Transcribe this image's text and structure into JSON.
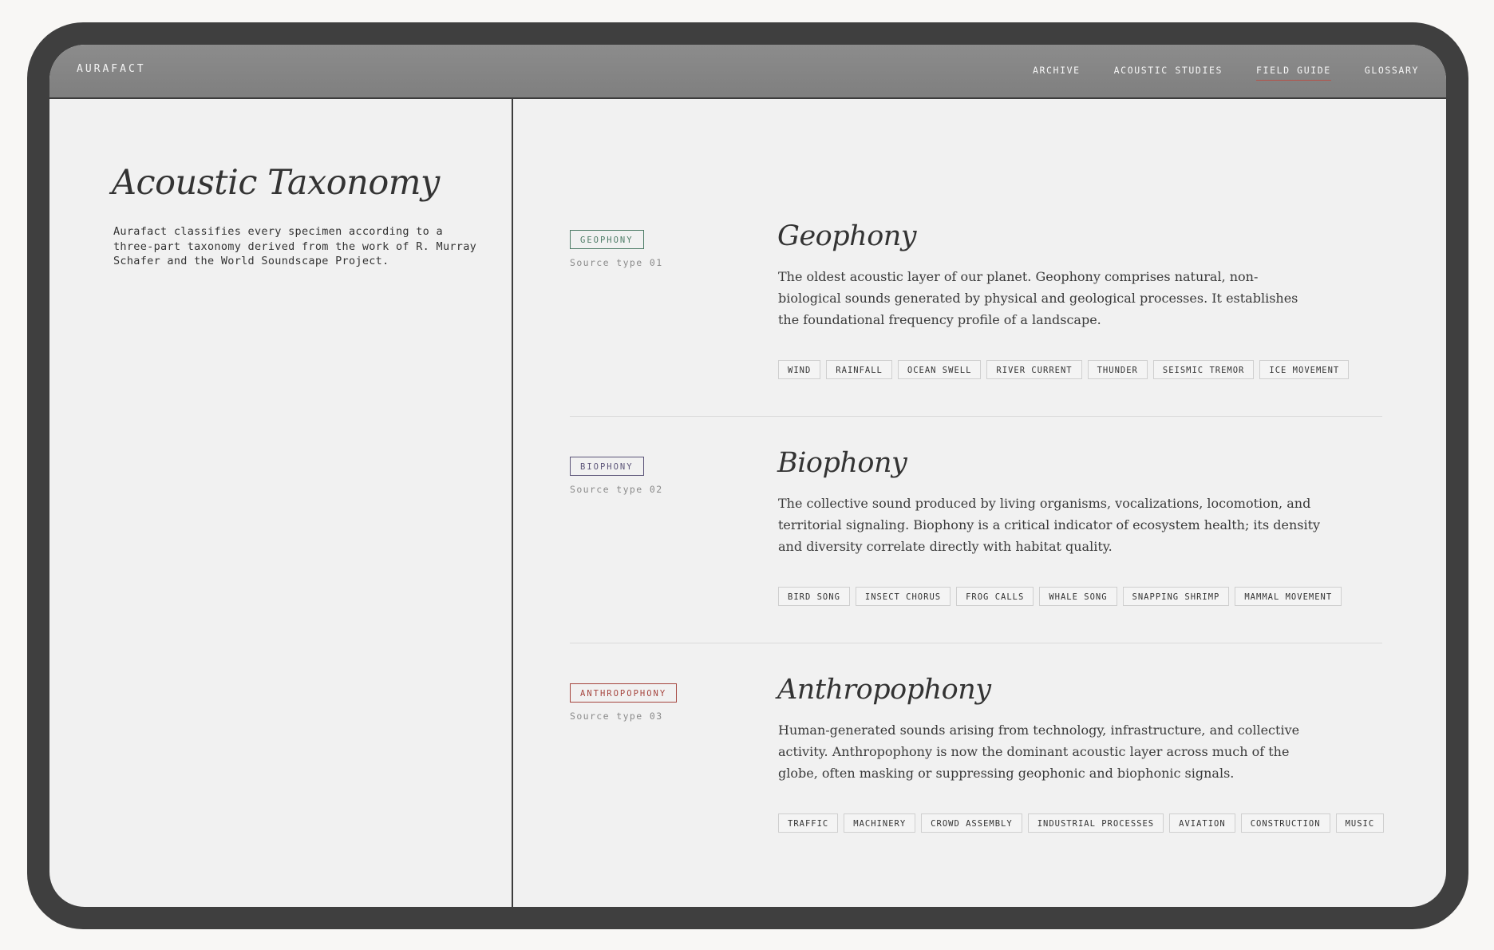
{
  "header": {
    "brand": "AURAFACT",
    "nav": [
      "ARCHIVE",
      "ACOUSTIC STUDIES",
      "FIELD GUIDE",
      "GLOSSARY"
    ],
    "active_nav": "FIELD GUIDE"
  },
  "sidebar": {
    "title": "Acoustic Taxonomy",
    "intro": "Aurafact classifies every specimen according to a three-part taxonomy derived from the work of R. Murray Schafer and the World Soundscape Project."
  },
  "colors": {
    "accent": "#b5524a",
    "geophony": "#4e7c67",
    "biophony": "#5b5478",
    "anthropophony": "#a5453e"
  },
  "sections": [
    {
      "badge": "GEOPHONY",
      "source_type": "Source type 01",
      "title": "Geophony",
      "description": "The oldest acoustic layer of our planet. Geophony comprises natural, non-biological sounds generated by physical and geological processes. It establishes the foundational frequency profile of a landscape.",
      "tags": [
        "WIND",
        "RAINFALL",
        "OCEAN SWELL",
        "RIVER CURRENT",
        "THUNDER",
        "SEISMIC TREMOR",
        "ICE MOVEMENT"
      ]
    },
    {
      "badge": "BIOPHONY",
      "source_type": "Source type 02",
      "title": "Biophony",
      "description": "The collective sound produced by living organisms, vocalizations, locomotion, and territorial signaling. Biophony is a critical indicator of ecosystem health; its density and diversity correlate directly with habitat quality.",
      "tags": [
        "BIRD SONG",
        "INSECT CHORUS",
        "FROG CALLS",
        "WHALE SONG",
        "SNAPPING SHRIMP",
        "MAMMAL MOVEMENT"
      ]
    },
    {
      "badge": "ANTHROPOPHONY",
      "source_type": "Source type 03",
      "title": "Anthropophony",
      "description": "Human-generated sounds arising from technology, infrastructure, and collective activity. Anthropophony is now the dominant acoustic layer across much of the globe, often masking or suppressing geophonic and biophonic signals.",
      "tags": [
        "TRAFFIC",
        "MACHINERY",
        "CROWD ASSEMBLY",
        "INDUSTRIAL PROCESSES",
        "AVIATION",
        "CONSTRUCTION",
        "MUSIC"
      ]
    }
  ]
}
